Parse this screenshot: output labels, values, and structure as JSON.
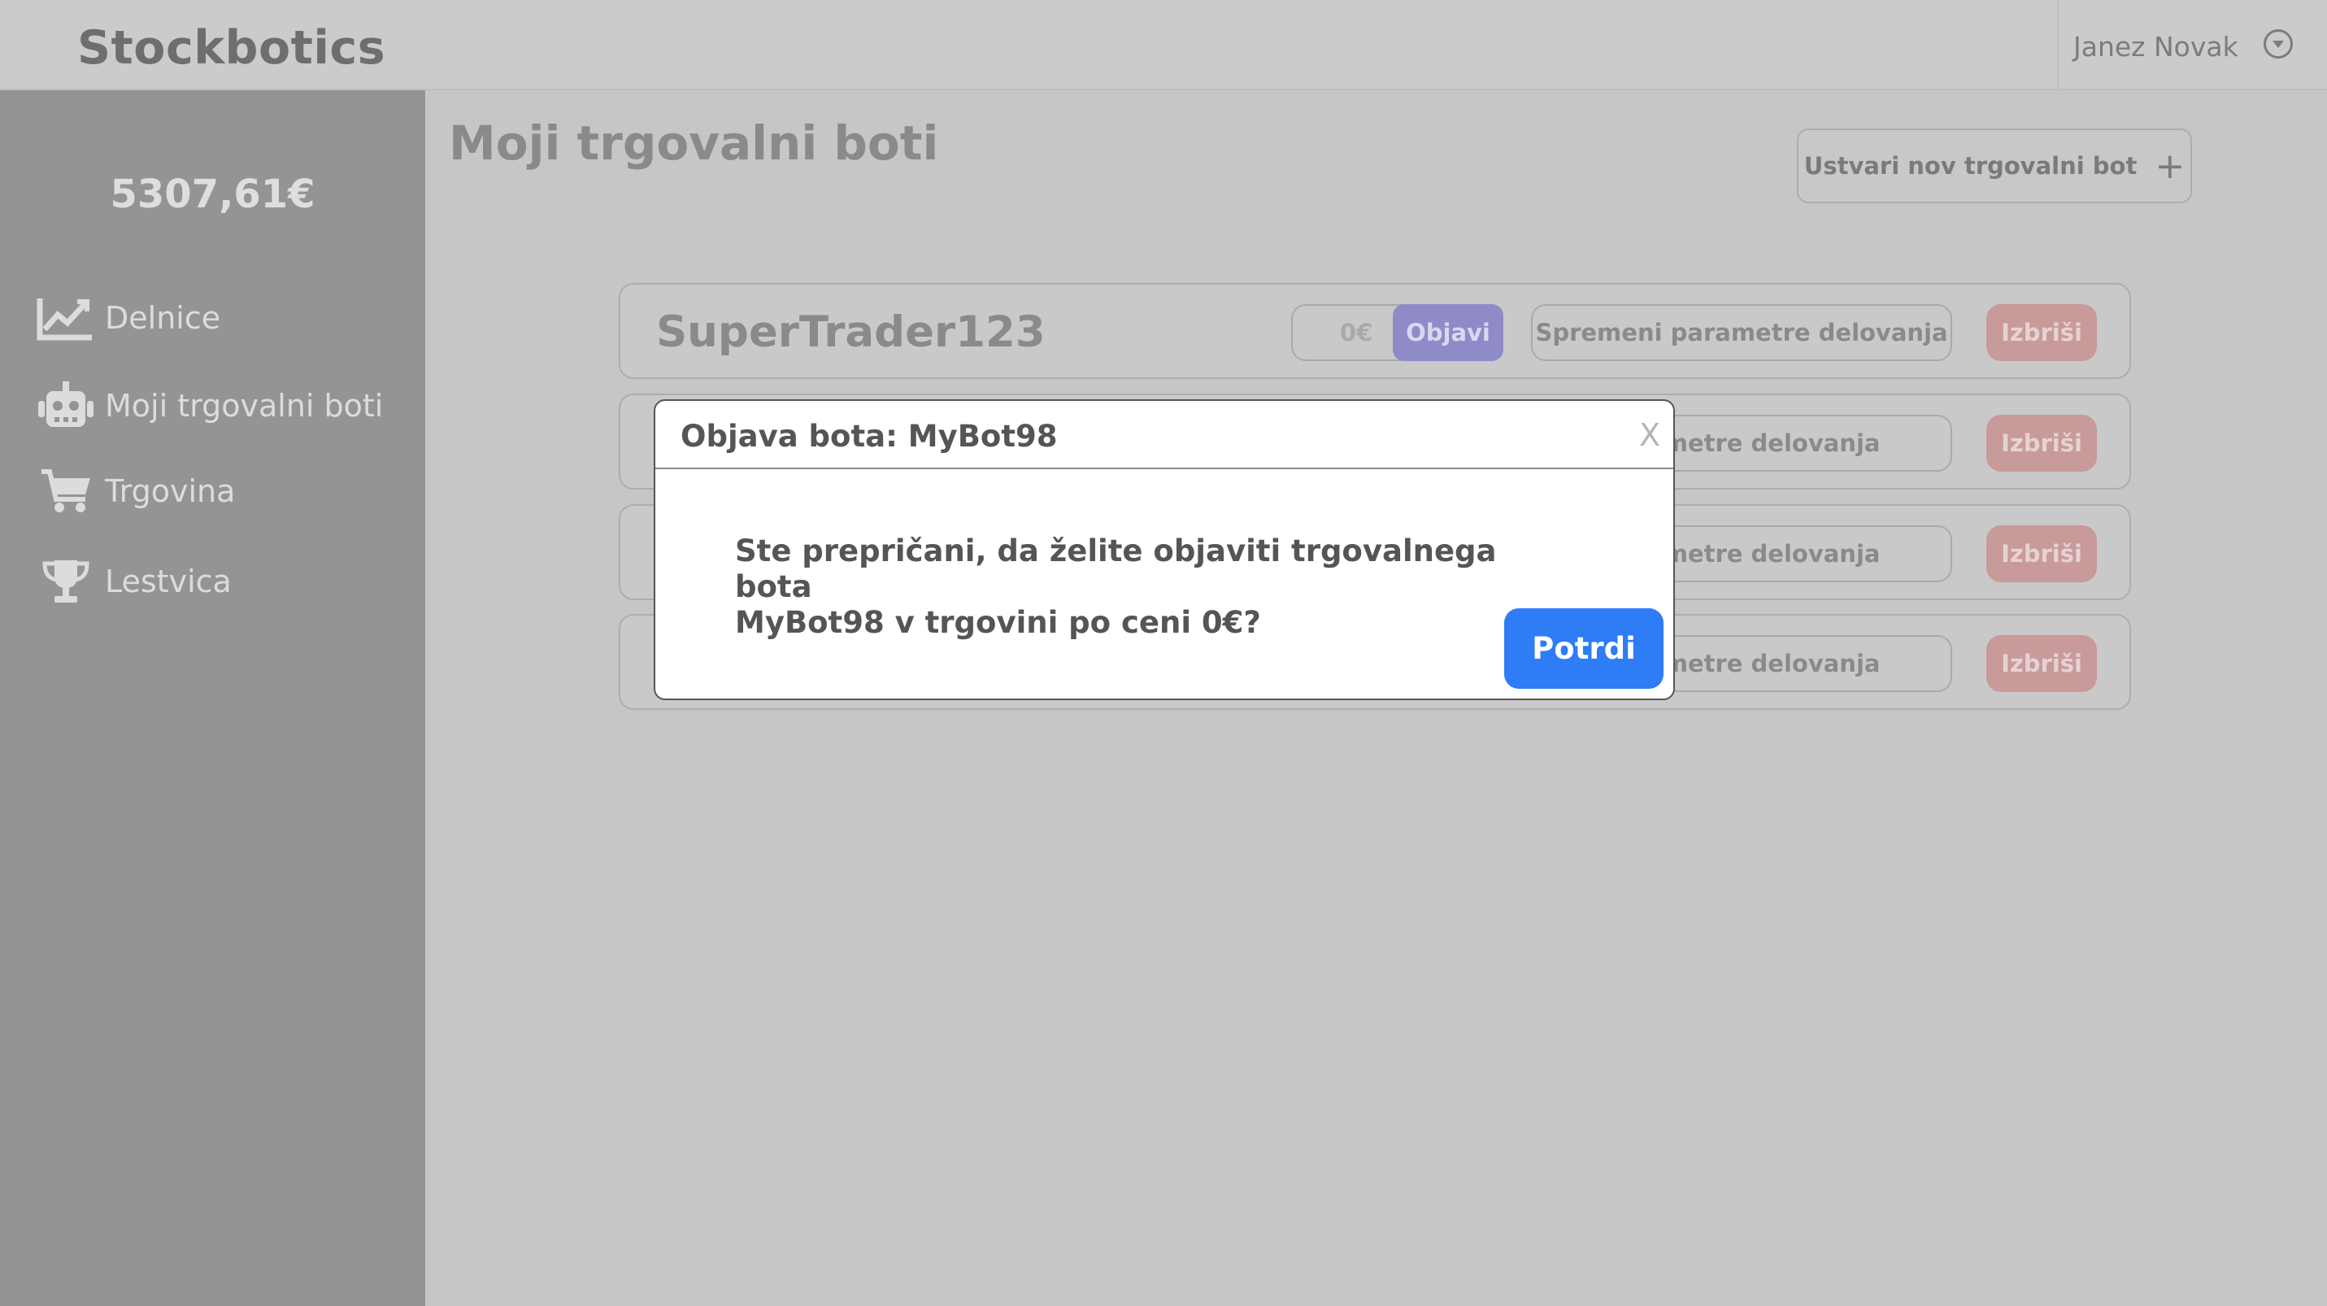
{
  "header": {
    "app_name": "Stockbotics",
    "user_name": "Janez Novak"
  },
  "sidebar": {
    "balance": "5307,61€",
    "items": [
      {
        "label": "Delnice",
        "icon": "chart-line-icon"
      },
      {
        "label": "Moji trgovalni boti",
        "icon": "robot-icon"
      },
      {
        "label": "Trgovina",
        "icon": "cart-icon"
      },
      {
        "label": "Lestvica",
        "icon": "trophy-icon"
      }
    ]
  },
  "main": {
    "title": "Moji trgovalni boti",
    "create_button": "Ustvari nov trgovalni bot",
    "create_icon": "+",
    "bots": [
      {
        "name": "SuperTrader123",
        "price": "0€",
        "publish": "Objavi",
        "params": "Spremeni parametre delovanja",
        "delete": "Izbriši"
      },
      {
        "params": "parametre delovanja",
        "delete": "Izbriši"
      },
      {
        "params": "parametre delovanja",
        "delete": "Izbriši"
      },
      {
        "params": "parametre delovanja",
        "delete": "Izbriši"
      }
    ]
  },
  "modal": {
    "title": "Objava bota: MyBot98",
    "close": "X",
    "message_line1": "Ste prepričani, da želite objaviti trgovalnega bota",
    "message_line2": "MyBot98 v trgovini po ceni 0€?",
    "confirm": "Potrdi"
  },
  "colors": {
    "accent": "#2e7cf6",
    "publish": "#8e8bc8",
    "delete": "#c89a9a"
  }
}
